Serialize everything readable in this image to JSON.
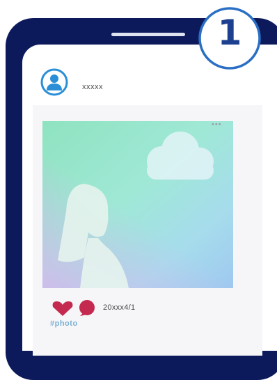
{
  "step": {
    "number": "1"
  },
  "post": {
    "username": "xxxxx",
    "date": "20xxx4/1",
    "hashtag": "#photo"
  },
  "icons": {
    "avatar": "user-avatar-icon",
    "more": "more-dots-icon",
    "heart": "heart-icon",
    "comment": "comment-bubble-icon"
  },
  "colors": {
    "phone_frame": "#0c1a5c",
    "accent_blue": "#1d3f8f",
    "heart": "#c42a50",
    "hashtag": "#7ab0d6"
  }
}
